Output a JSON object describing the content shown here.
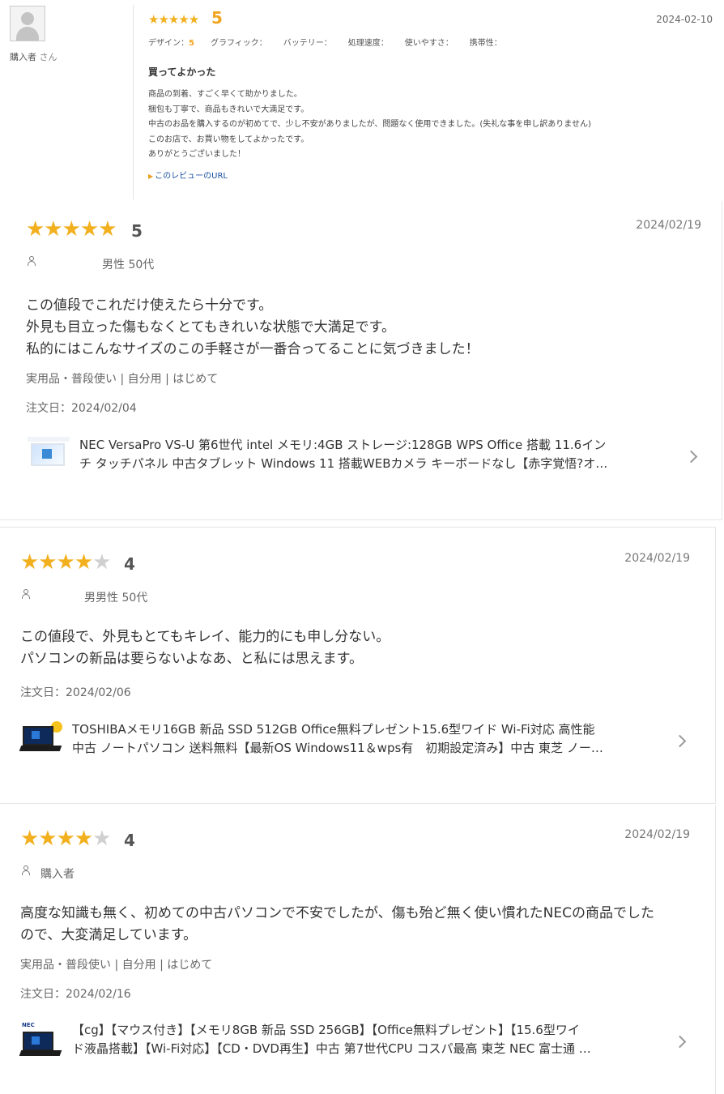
{
  "review1": {
    "reviewer": "購入者",
    "reviewer_suffix": "さん",
    "stars": "★★★★★",
    "score": "5",
    "date": "2024-02-10",
    "attributes": [
      {
        "label": "デザイン：",
        "value": "5"
      },
      {
        "label": "グラフィック：",
        "value": ""
      },
      {
        "label": "バッテリー：",
        "value": ""
      },
      {
        "label": "処理速度：",
        "value": ""
      },
      {
        "label": "使いやすさ：",
        "value": ""
      },
      {
        "label": "携帯性：",
        "value": ""
      }
    ],
    "title": "買ってよかった",
    "body": [
      "商品の到着、すごく早くて助かりました。",
      "梱包も丁寧で、商品もきれいで大満足です。",
      "中古のお品を購入するのが初めてで、少し不安がありましたが、問題なく使用できました。(失礼な事を申し訳ありません)",
      "このお店で、お買い物をしてよかったです。",
      "ありがとうございました！"
    ],
    "url_link": "このレビューのURL"
  },
  "review2": {
    "stars_on": "★★★★★",
    "stars_off": "",
    "score": "5",
    "date": "2024/02/19",
    "meta": "男性  50代",
    "comment": [
      "この値段でこれだけ使えたら十分です。",
      "外見も目立った傷もなくとてもきれいな状態で大満足です。",
      "私的にはこんなサイズのこの手軽さが一番合ってることに気づきました！"
    ],
    "usage": "実用品・普段使い | 自分用 | はじめて",
    "order_date": "注文日：2024/02/04",
    "product_lines": [
      "NEC VersaPro VS-U 第6世代 intel メモリ:4GB ストレージ:128GB WPS Office 搭載 11.6イン",
      "チ タッチパネル 中古タブレット Windows 11 搭載WEBカメラ キーボードなし【赤字覚悟?オ…"
    ]
  },
  "review3": {
    "stars_on": "★★★★",
    "stars_off": "★",
    "score": "4",
    "date": "2024/02/19",
    "meta": "男男性  50代",
    "comment": [
      "この値段で、外見もとてもキレイ、能力的にも申し分ない。",
      "パソコンの新品は要らないよなあ、と私には思えます。"
    ],
    "order_date": "注文日：2024/02/06",
    "product_lines": [
      "TOSHIBAメモリ16GB 新品 SSD 512GB Office無料プレゼント15.6型ワイド Wi-Fi対応 高性能",
      "中古 ノートパソコン 送料無料【最新OS Windows11＆wps有　初期設定済み】中古 東芝 ノー…"
    ]
  },
  "review4": {
    "stars_on": "★★★★",
    "stars_off": "★",
    "score": "4",
    "date": "2024/02/19",
    "meta": "購入者",
    "comment": [
      "高度な知識も無く、初めての中古パソコンで不安でしたが、傷も殆ど無く使い慣れたNECの商品でした",
      "ので、大変満足しています。"
    ],
    "usage": "実用品・普段使い | 自分用 | はじめて",
    "order_date": "注文日：2024/02/16",
    "product_lines": [
      "【cg】【マウス付き】【メモリ8GB 新品 SSD 256GB】【Office無料プレゼント】【15.6型ワイ",
      "ド液晶搭載】【Wi-Fi対応】【CD・DVD再生】中古 第7世代CPU コスパ最高 東芝 NEC 富士通 …"
    ],
    "thumb_brand": "NEC"
  },
  "colors": {
    "star": "#f2b01e",
    "star_off": "#d0d0d0",
    "score_orange": "#f2a51e",
    "link": "#1a4fa0"
  }
}
